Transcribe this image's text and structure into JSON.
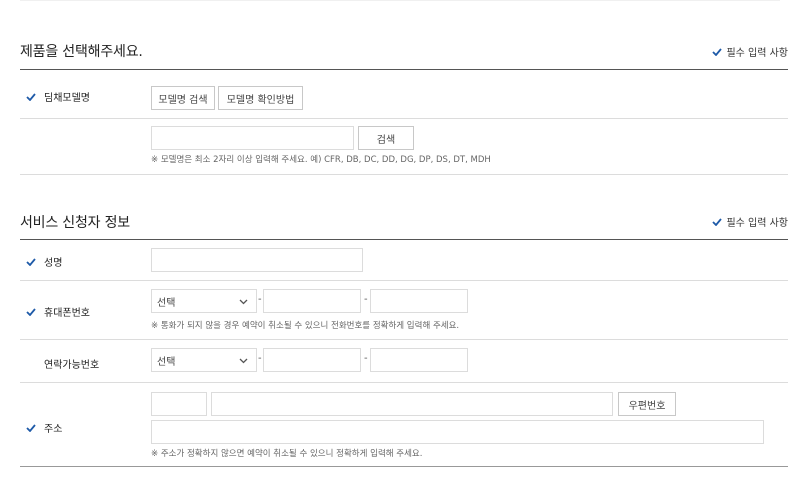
{
  "product_section": {
    "title": "제품을 선택해주세요.",
    "required_note": "필수 입력 사항",
    "model_row": {
      "label": "딤채모델명",
      "model_search_button": "모델명 검색",
      "model_howto_button": "모델명 확인방법"
    },
    "search_row": {
      "search_button": "검색",
      "hint": "※ 모델명은 최소 2자리 이상 입력해 주세요. 예) CFR, DB, DC, DD, DG, DP, DS, DT, MDH"
    }
  },
  "applicant_section": {
    "title": "서비스 신청자 정보",
    "required_note": "필수 입력 사항",
    "name_row": {
      "label": "성명"
    },
    "mobile_row": {
      "label": "휴대폰번호",
      "select_value": "선택",
      "separator_1": "-",
      "separator_2": "-",
      "hint": "※ 통화가 되지 않을 경우 예약이 취소될 수 있으니 전화번호를 정확하게 입력해 주세요."
    },
    "contact_row": {
      "label": "연락가능번호",
      "select_value": "선택",
      "separator_1": "-",
      "separator_2": "-"
    },
    "address_row": {
      "label": "주소",
      "postcode_button": "우편번호",
      "hint": "※ 주소가 정확하지 않으면 예약이 취소될 수 있으니 정확하게 입력해 주세요."
    }
  },
  "colors": {
    "check_accent": "#1e5aa8",
    "divider_dark": "#555555",
    "divider_light": "#dcdcdc"
  },
  "icons": {
    "required_check": "check-icon",
    "select_arrow": "chevron-down-icon"
  }
}
